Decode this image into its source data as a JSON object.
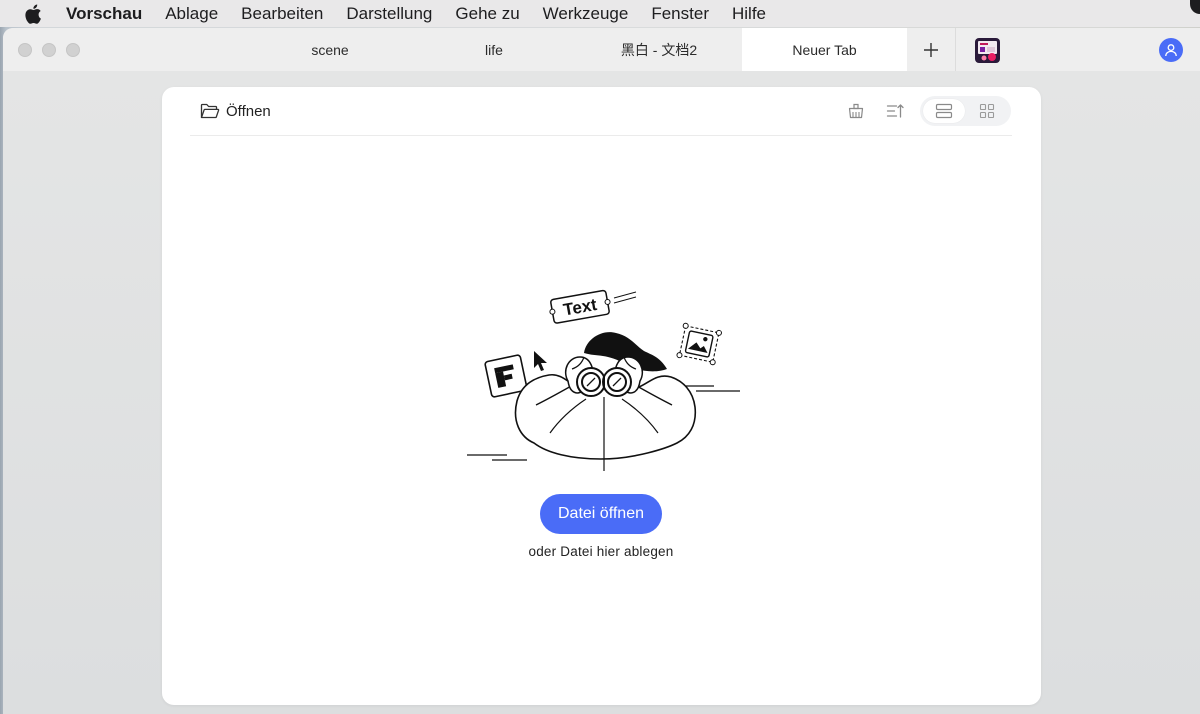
{
  "menubar": {
    "app_name": "Vorschau",
    "items": [
      "Ablage",
      "Bearbeiten",
      "Darstellung",
      "Gehe zu",
      "Werkzeuge",
      "Fenster",
      "Hilfe"
    ]
  },
  "tabs": [
    {
      "label": "scene",
      "active": false
    },
    {
      "label": "life",
      "active": false
    },
    {
      "label": "黑白 - 文档2",
      "active": false
    },
    {
      "label": "Neuer Tab",
      "active": true
    }
  ],
  "toolbar": {
    "open_label": "Öffnen",
    "icons": [
      "clean-icon",
      "sort-icon",
      "list-view-icon",
      "grid-view-icon"
    ],
    "active_view": "list"
  },
  "empty_state": {
    "illustration_tag": "Text",
    "button_label": "Datei öffnen",
    "hint": "oder Datei hier ablegen"
  },
  "colors": {
    "accent": "#4a6cf7",
    "card_background": "#ffffff",
    "tabbar_background": "#eeeeee"
  }
}
